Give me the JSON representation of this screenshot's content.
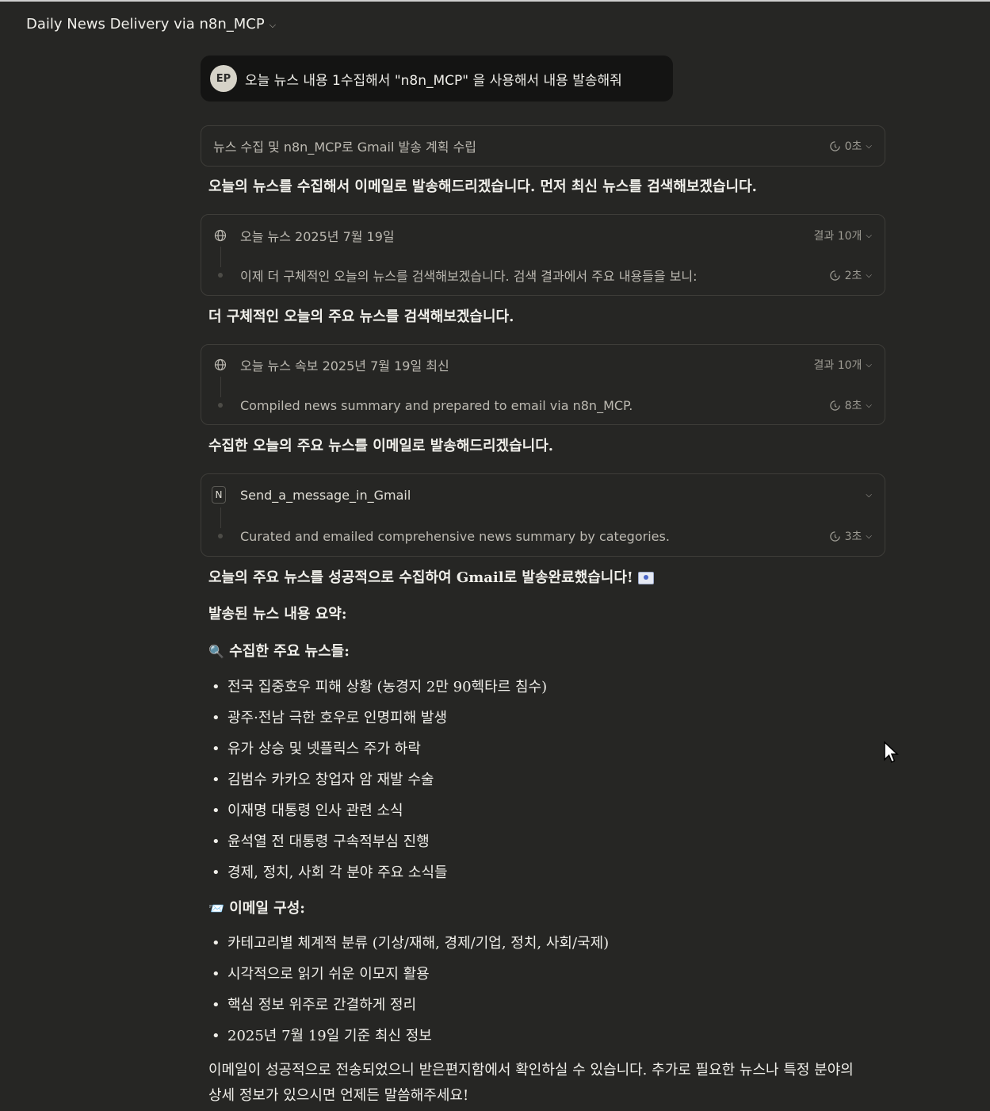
{
  "header": {
    "title": "Daily News Delivery via n8n_MCP"
  },
  "user_message": {
    "avatar": "EP",
    "text": "오늘 뉴스 내용 1수집해서 \"n8n_MCP\" 을 사용해서 내용 발송해줘"
  },
  "plan_card": {
    "label": "뉴스 수집 및 n8n_MCP로 Gmail 발송 계획 수립",
    "time": "0초"
  },
  "para1": "오늘의 뉴스를 수집해서 이메일로 발송해드리겠습니다. 먼저 최신 뉴스를 검색해보겠습니다.",
  "search1": {
    "query": "오늘 뉴스 2025년 7월 19일",
    "results": "결과 10개",
    "step": "이제 더 구체적인 오늘의 뉴스를 검색해보겠습니다. 검색 결과에서 주요 내용들을 보니:",
    "time": "2초"
  },
  "para2": "더 구체적인 오늘의 주요 뉴스를 검색해보겠습니다.",
  "search2": {
    "query": "오늘 뉴스 속보 2025년 7월 19일 최신",
    "results": "결과 10개",
    "step": "Compiled news summary and prepared to email via n8n_MCP.",
    "time": "8초"
  },
  "para3": "수집한 오늘의 주요 뉴스를 이메일로 발송해드리겠습니다.",
  "tool_card": {
    "icon_letter": "N",
    "tool": "Send_a_message_in_Gmail",
    "step": "Curated and emailed comprehensive news summary by categories.",
    "time": "3초"
  },
  "para4": "오늘의 주요 뉴스를 성공적으로 수집하여 Gmail로 발송완료했습니다!",
  "summary_heading": "발송된 뉴스 내용 요약:",
  "news_heading": {
    "emoji": "🔍",
    "text": "수집한 주요 뉴스들:"
  },
  "news_items": [
    "전국 집중호우 피해 상황 (농경지 2만 90헥타르 침수)",
    "광주·전남 극한 호우로 인명피해 발생",
    "유가 상승 및 넷플릭스 주가 하락",
    "김범수 카카오 창업자 암 재발 수술",
    "이재명 대통령 인사 관련 소식",
    "윤석열 전 대통령 구속적부심 진행",
    "경제, 정치, 사회 각 분야 주요 소식들"
  ],
  "email_heading": {
    "emoji": "📨",
    "text": "이메일 구성:"
  },
  "email_items": [
    "카테고리별 체계적 분류 (기상/재해, 경제/기업, 정치, 사회/국제)",
    "시각적으로 읽기 쉬운 이모지 활용",
    "핵심 정보 위주로 간결하게 정리",
    "2025년 7월 19일 기준 최신 정보"
  ],
  "closing": "이메일이 성공적으로 전송되었으니 받은편지함에서 확인하실 수 있습니다. 추가로 필요한 뉴스나 특정 분야의 상세 정보가 있으시면 언제든 말씀해주세요!"
}
